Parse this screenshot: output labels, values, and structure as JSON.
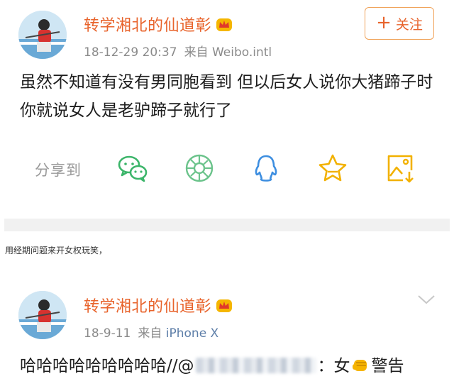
{
  "post1": {
    "username": "转学湘北的仙道彰",
    "time": "18-12-29 20:37",
    "source_prefix": "来自",
    "source": "Weibo.intl",
    "follow_label": "关注",
    "text": "虽然不知道有没有男同胞看到 但以后女人说你大猪蹄子时 你就说女人是老驴蹄子就行了",
    "share_label": "分享到",
    "share_icons": [
      "wechat-icon",
      "moments-icon",
      "qq-icon",
      "favorite-star-icon",
      "save-image-icon"
    ]
  },
  "caption": "用经期问题来开女权玩笑，",
  "post2": {
    "username": "转学湘北的仙道彰",
    "time": "18-9-11",
    "source_prefix": "来自",
    "source": "iPhone X",
    "text_before": "哈哈哈哈哈哈哈哈哈//@",
    "text_after": "：女",
    "text_end": "警告"
  },
  "colors": {
    "brand_orange": "#e8632b",
    "share_green": "#3cb56a",
    "share_blue": "#3d8ee0",
    "share_yellow": "#f2b100"
  }
}
